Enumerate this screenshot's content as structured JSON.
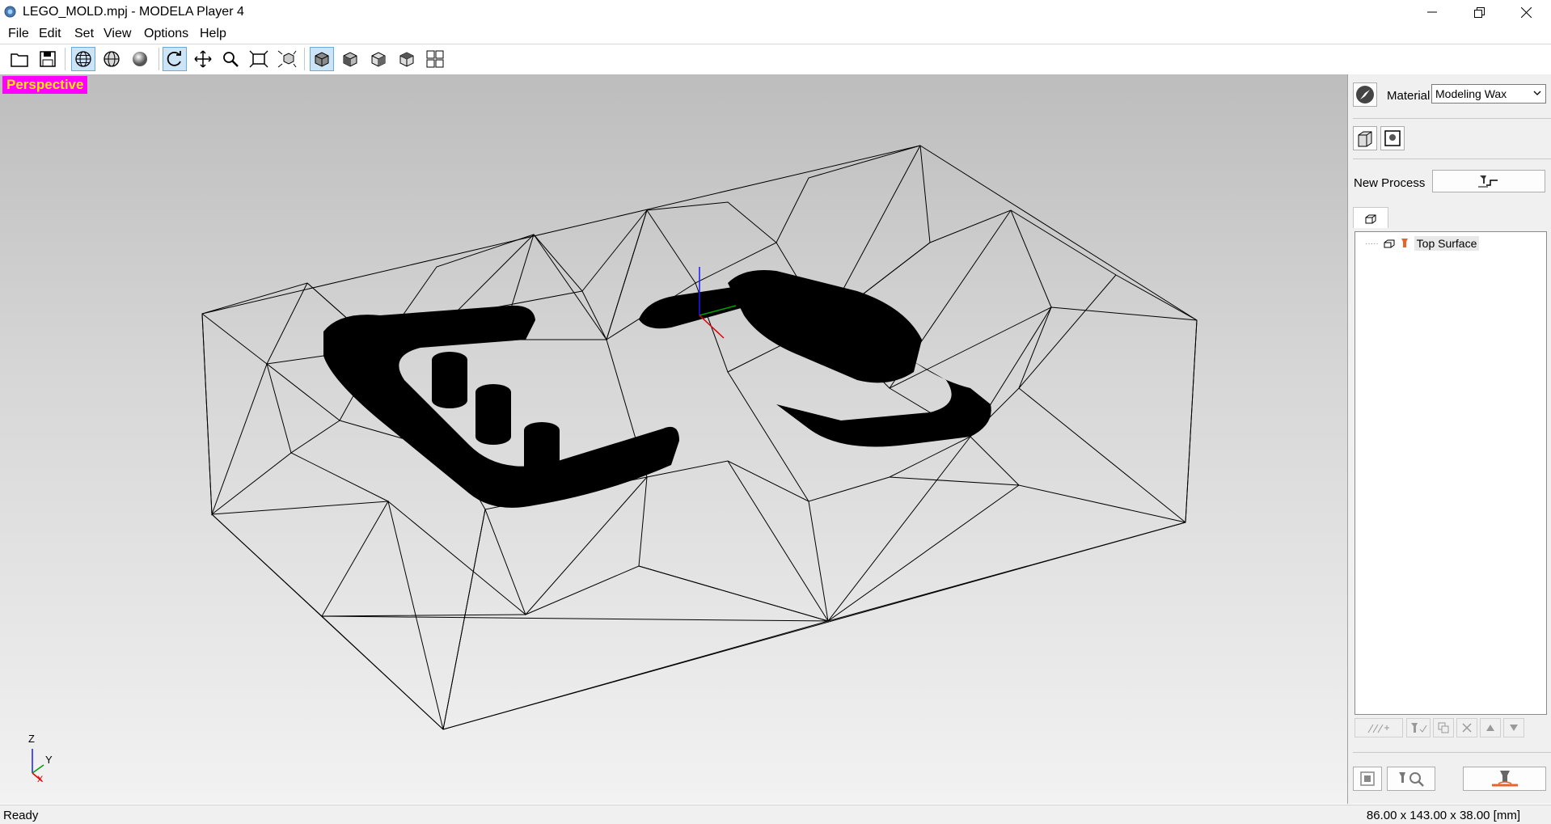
{
  "window": {
    "title": "LEGO_MOLD.mpj - MODELA Player 4",
    "icons": [
      "app-icon",
      "minimize-icon",
      "restore-icon",
      "close-icon"
    ]
  },
  "menu": {
    "items": [
      "File",
      "Edit",
      "Set",
      "View",
      "Options",
      "Help"
    ]
  },
  "toolbar": {
    "buttons": [
      "open-icon",
      "save-icon",
      "wireframe-icon",
      "shaded-wire-icon",
      "shaded-icon",
      "rotate-icon",
      "pan-icon",
      "zoom-icon",
      "fit-icon",
      "zoom-selection-icon",
      "view-iso-icon",
      "view-front-icon",
      "view-side-icon",
      "view-back-icon",
      "multi-view-icon"
    ],
    "active": [
      "wireframe-icon",
      "rotate-icon",
      "view-iso-icon"
    ]
  },
  "viewport": {
    "view_label": "Perspective",
    "axis": {
      "z": "Z",
      "y": "Y",
      "x": "X"
    }
  },
  "panel": {
    "material_label": "Material",
    "material_value": "Modeling Wax",
    "new_process_label": "New Process",
    "tree": [
      {
        "label": "Top Surface"
      }
    ]
  },
  "status": {
    "left": "Ready",
    "right": "86.00 x 143.00 x 38.00 [mm]"
  },
  "colors": {
    "view_label_bg": "#ff00ff",
    "view_label_text": "#ffe800",
    "viewport_top": "#bdbdbd",
    "viewport_bottom": "#f2f2f2"
  }
}
